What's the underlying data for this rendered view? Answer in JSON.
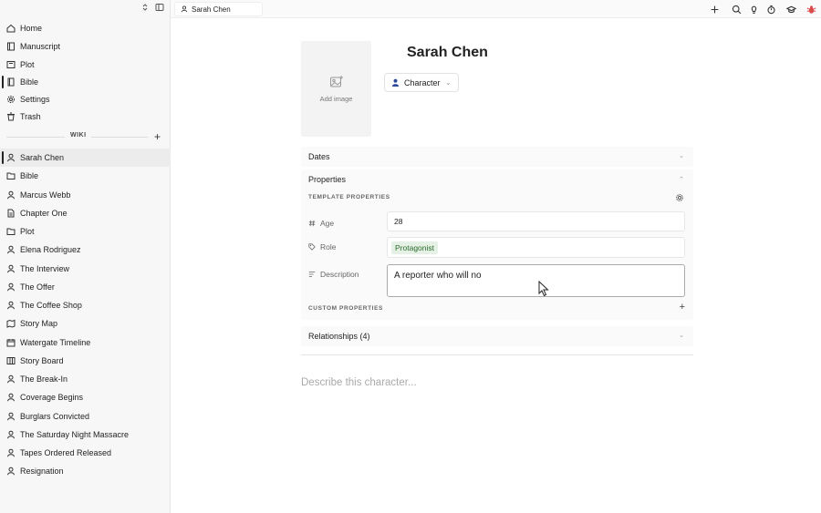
{
  "sidebar": {
    "nav": [
      {
        "label": "Home",
        "icon": "home-icon"
      },
      {
        "label": "Manuscript",
        "icon": "book-icon"
      },
      {
        "label": "Plot",
        "icon": "plot-icon"
      },
      {
        "label": "Bible",
        "icon": "bible-icon"
      },
      {
        "label": "Settings",
        "icon": "gear-icon"
      },
      {
        "label": "Trash",
        "icon": "trash-icon"
      }
    ],
    "wiki_label": "WIKI",
    "wiki": [
      {
        "label": "Sarah Chen",
        "icon": "person-icon"
      },
      {
        "label": "Bible",
        "icon": "folder-icon"
      },
      {
        "label": "Marcus Webb",
        "icon": "person-icon"
      },
      {
        "label": "Chapter One",
        "icon": "document-icon"
      },
      {
        "label": "Plot",
        "icon": "folder-icon"
      },
      {
        "label": "Elena Rodriguez",
        "icon": "person-icon"
      },
      {
        "label": "The Interview",
        "icon": "person-icon"
      },
      {
        "label": "The Offer",
        "icon": "person-icon"
      },
      {
        "label": "The Coffee Shop",
        "icon": "person-icon"
      },
      {
        "label": "Story Map",
        "icon": "map-icon"
      },
      {
        "label": "Watergate Timeline",
        "icon": "calendar-icon"
      },
      {
        "label": "Story Board",
        "icon": "board-icon"
      },
      {
        "label": "The Break-In",
        "icon": "person-icon"
      },
      {
        "label": "Coverage Begins",
        "icon": "person-icon"
      },
      {
        "label": "Burglars Convicted",
        "icon": "person-icon"
      },
      {
        "label": "The Saturday Night Massacre",
        "icon": "person-icon"
      },
      {
        "label": "Tapes Ordered Released",
        "icon": "person-icon"
      },
      {
        "label": "Resignation",
        "icon": "person-icon"
      }
    ]
  },
  "tab": {
    "label": "Sarah Chen"
  },
  "page": {
    "title": "Sarah Chen",
    "add_image": "Add image",
    "type_label": "Character",
    "dates_label": "Dates",
    "properties_label": "Properties",
    "template_props_label": "TEMPLATE PROPERTIES",
    "age_label": "Age",
    "age_value": "28",
    "role_label": "Role",
    "role_value": "Protagonist",
    "desc_label": "Description",
    "desc_value": "A reporter who will no",
    "custom_props_label": "CUSTOM PROPERTIES",
    "relationships_label": "Relationships (4)",
    "editor_placeholder": "Describe this character..."
  },
  "colors": {
    "accent_icon": "#2b4a9b",
    "tag_bg": "#e4f1e4",
    "tag_text": "#2e6b2e",
    "bug_icon": "#d94a4a"
  }
}
